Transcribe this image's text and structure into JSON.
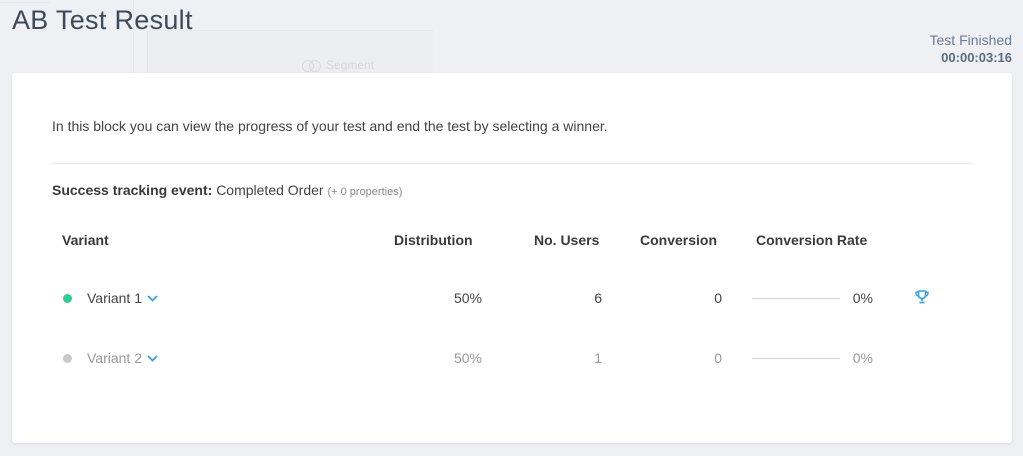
{
  "header": {
    "title": "AB Test Result",
    "status_label": "Test Finished",
    "status_timer": "00:00:03:16"
  },
  "background": {
    "segment_label": "Segment"
  },
  "card": {
    "description": "In this block you can view the progress of your test and end the test by selecting a winner.",
    "tracking": {
      "label": "Success tracking event:",
      "event": "Completed Order",
      "properties": "(+ 0 properties)"
    }
  },
  "table": {
    "columns": {
      "variant": "Variant",
      "distribution": "Distribution",
      "users": "No. Users",
      "conversion": "Conversion",
      "conversion_rate": "Conversion Rate"
    },
    "rows": [
      {
        "name": "Variant 1",
        "status_color": "#2ecc8f",
        "text_color": "#444444",
        "distribution": "50%",
        "users": "6",
        "conversion": "0",
        "conversion_rate": "0%",
        "rate_fraction": 0,
        "winner": true
      },
      {
        "name": "Variant 2",
        "status_color": "#c9c9c9",
        "text_color": "#999999",
        "distribution": "50%",
        "users": "1",
        "conversion": "0",
        "conversion_rate": "0%",
        "rate_fraction": 0,
        "winner": false
      }
    ]
  },
  "icons": {
    "chevron": "chevron-down-icon",
    "trophy": "trophy-icon",
    "segment": "segment-icon"
  },
  "colors": {
    "accent": "#3aa0e0",
    "title": "#3c4a5c"
  }
}
